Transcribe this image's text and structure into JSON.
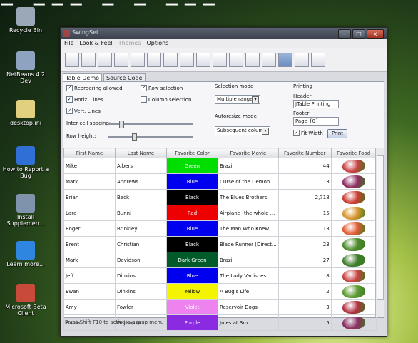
{
  "desktop": {
    "banner_text": "– ––– – – –––",
    "icons": [
      {
        "label": "Recycle Bin",
        "color": "#9aa8b8"
      },
      {
        "label": "NetBeans 4.2 Dev",
        "color": "#8ea3c0"
      },
      {
        "label": "desktop.ini",
        "color": "#e0d080"
      },
      {
        "label": "How to Report a Bug",
        "color": "#2f6fd6"
      },
      {
        "label": "Install Supplemen...",
        "color": "#7f93ad"
      },
      {
        "label": "Learn more...",
        "color": "#2f86e0"
      },
      {
        "label": "Microsoft Beta Client",
        "color": "#c84a3a"
      }
    ]
  },
  "window": {
    "title": "SwingSet",
    "buttons": [
      "–",
      "□",
      "x"
    ],
    "menu": [
      "File",
      "Look & Feel",
      "Themes",
      "Options"
    ],
    "toolbar_icons": [
      "internal-frame-icon",
      "buttons-icon",
      "color-chooser-icon",
      "combobox-icon",
      "file-chooser-icon",
      "html-icon",
      "list-icon",
      "option-pane-icon",
      "progress-bar-icon",
      "scroll-pane-icon",
      "slider-icon",
      "split-pane-icon",
      "tabbed-pane-icon",
      "table-icon",
      "toolbar-icon",
      "tree-icon"
    ],
    "tabs": [
      "Table Demo",
      "Source Code"
    ]
  },
  "config": {
    "reordering": "Reordering allowed",
    "horiz_lines": "Horiz. Lines",
    "vert_lines": "Vert. Lines",
    "row_selection": "Row selection",
    "column_selection": "Column selection",
    "intercell_spacing": "Inter-cell spacing:",
    "row_height": "Row height:",
    "selection_mode_label": "Selection mode",
    "selection_mode_value": "Multiple ranges",
    "autoresize_label": "Autoresize mode",
    "autoresize_value": "Subsequent columns",
    "printing_label": "Printing",
    "header_label": "Header",
    "header_value": "JTable Printing",
    "footer_label": "Footer",
    "footer_value": "Page {0}",
    "fit_width": "Fit Width",
    "print_button": "Print"
  },
  "table": {
    "headers": [
      "First Name",
      "Last Name",
      "Favorite Color",
      "Favorite Movie",
      "Favorite Number",
      "Favorite Food"
    ],
    "rows": [
      {
        "first": "Mike",
        "last": "Albers",
        "color": "Green",
        "color_hex": "#00dd00",
        "movie": "Brazil",
        "number": "44",
        "food": "#c94040"
      },
      {
        "first": "Mark",
        "last": "Andrews",
        "color": "Blue",
        "color_hex": "#0000ee",
        "movie": "Curse of the Demon",
        "number": "3",
        "food": "#8e2b62"
      },
      {
        "first": "Brian",
        "last": "Beck",
        "color": "Black",
        "color_hex": "#000000",
        "movie": "The Blues Brothers",
        "number": "2,718",
        "food": "#cc3a30"
      },
      {
        "first": "Lara",
        "last": "Bunni",
        "color": "Red",
        "color_hex": "#ee0000",
        "movie": "Airplane (the whole ...",
        "number": "15",
        "food": "#d8952c"
      },
      {
        "first": "Roger",
        "last": "Brinkley",
        "color": "Blue",
        "color_hex": "#0000ee",
        "movie": "The Man Who Knew ...",
        "number": "13",
        "food": "#e05a30"
      },
      {
        "first": "Brent",
        "last": "Christian",
        "color": "Black",
        "color_hex": "#000000",
        "movie": "Blade Runner (Direct...",
        "number": "23",
        "food": "#4c8a2c"
      },
      {
        "first": "Mark",
        "last": "Davidson",
        "color": "Dark Green",
        "color_hex": "#005a2a",
        "movie": "Brazil",
        "number": "27",
        "food": "#3d7d2a"
      },
      {
        "first": "Jeff",
        "last": "Dinkins",
        "color": "Blue",
        "color_hex": "#0000ee",
        "movie": "The Lady Vanishes",
        "number": "8",
        "food": "#c94040"
      },
      {
        "first": "Ewan",
        "last": "Dinkins",
        "color": "Yellow",
        "color_hex": "#f4f400",
        "color_text": "#000000",
        "movie": "A Bug's Life",
        "number": "2",
        "food": "#5c9a32"
      },
      {
        "first": "Amy",
        "last": "Fowler",
        "color": "Violet",
        "color_hex": "#ee82ee",
        "movie": "Reservoir Dogs",
        "number": "3",
        "food": "#b03040"
      },
      {
        "first": "Hania",
        "last": "Gajewska",
        "color": "Purple",
        "color_hex": "#8a2be2",
        "movie": "Jules at 3m",
        "number": "5",
        "food": "#8e2b62"
      }
    ]
  },
  "status": "Press Shift-F10 to activate popup menu"
}
